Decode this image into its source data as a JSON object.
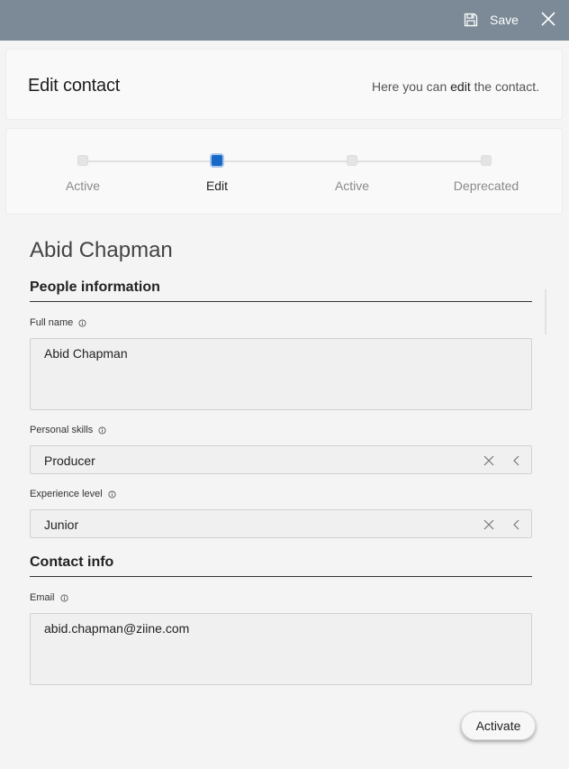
{
  "toolbar": {
    "save_label": "Save"
  },
  "header": {
    "title": "Edit contact",
    "subtitle_before": "Here you can ",
    "subtitle_em": "edit",
    "subtitle_after": " the contact."
  },
  "stages": [
    {
      "label": "Active",
      "state": "past"
    },
    {
      "label": "Edit",
      "state": "current"
    },
    {
      "label": "Active",
      "state": "future"
    },
    {
      "label": "Deprecated",
      "state": "future"
    }
  ],
  "record": {
    "name": "Abid Chapman"
  },
  "sections": {
    "people": "People information",
    "contact": "Contact info"
  },
  "fields": {
    "full_name": {
      "label": "Full name",
      "value": "Abid Chapman"
    },
    "skills": {
      "label": "Personal skills",
      "value": "Producer"
    },
    "experience": {
      "label": "Experience level",
      "value": "Junior"
    },
    "email": {
      "label": "Email",
      "value": "abid.chapman@ziine.com"
    }
  },
  "actions": {
    "activate": "Activate"
  },
  "colors": {
    "topbar": "#7b8a96",
    "accent": "#1769c7"
  }
}
